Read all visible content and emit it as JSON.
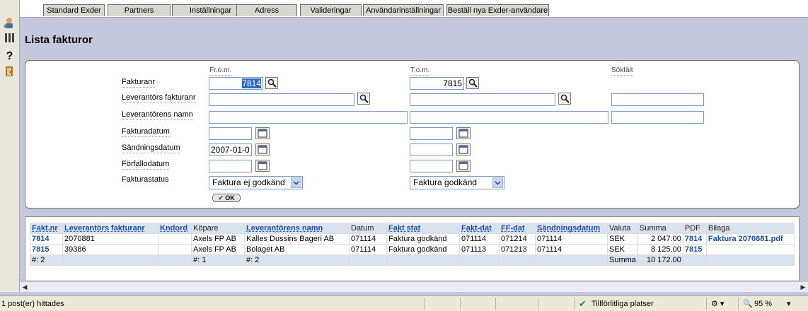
{
  "tabs": [
    "Standard Exder",
    "Partners",
    "Inställningar",
    "Adress",
    "Valideringar",
    "Användarinställningar",
    "Beställ nya Exder-användare"
  ],
  "left_icons": [
    "user-gear-icon",
    "columns-icon",
    "help-icon",
    "exit-door-icon"
  ],
  "page_title": "Lista fakturor",
  "form": {
    "col_from": "Fr.o.m.",
    "col_to": "T.o.m.",
    "col_search": "Sökfält",
    "labels": {
      "fakturanr": "Fakturanr",
      "lev_fakturanr": "Leverantörs fakturanr",
      "lev_namn": "Leverantörens namn",
      "fakturadatum": "Fakturadatum",
      "sandningsdatum": "Sändningsdatum",
      "forfallodatum": "Förfallodatum",
      "fakturastatus": "Fakturastatus"
    },
    "values": {
      "fakturanr_from": "7814",
      "fakturanr_to": "7815",
      "lev_fakturanr_from": "",
      "lev_fakturanr_to": "",
      "lev_fakturanr_search": "",
      "lev_namn_from": "",
      "lev_namn_to": "",
      "lev_namn_search": "",
      "fakturadatum_from": "",
      "fakturadatum_to": "",
      "sandningsdatum_from": "2007-01-0",
      "sandningsdatum_to": "",
      "forfallodatum_from": "",
      "forfallodatum_to": "",
      "status_from": "Faktura ej godkänd",
      "status_to": "Faktura godkänd"
    },
    "ok_label": "OK"
  },
  "results": {
    "headers": [
      "Fakt.nr",
      "Leverantörs fakturanr",
      "Kndord",
      "Köpare",
      "Leverantörens namn",
      "Datum",
      "Fakt stat",
      "Fakt-dat",
      "FF-dat",
      "Sändningsdatum",
      "Valuta",
      "Summa",
      "PDF",
      "Bilaga"
    ],
    "rows": [
      [
        "7814",
        "2070881",
        "",
        "Axels FP AB",
        "Kalles Dussins Bageri AB",
        "071114",
        "Faktura godkänd",
        "071114",
        "071214",
        "071114",
        "SEK",
        "2 047.00",
        "7814",
        "Faktura 2070881.pdf"
      ],
      [
        "7815",
        "39386",
        "",
        "Axels FP AB",
        "Bolaget AB",
        "071114",
        "Faktura godkänd",
        "071113",
        "071213",
        "071114",
        "SEK",
        "8 125.00",
        "7815",
        ""
      ]
    ],
    "footer": {
      "count_fakt": "#: 2",
      "count_kopare": "#: 1",
      "count_lev": "#: 2",
      "summa_label": "Summa",
      "summa_value": "10 172.00"
    }
  },
  "statusbar": {
    "left_text": "1 post(er) hittades",
    "zone_text": "Tillförlitliga platser",
    "zoom": "95 %"
  },
  "colors": {
    "link": "#1c4f9c",
    "header_bg": "#dbe2ef",
    "page_bg": "#c5c8dc"
  }
}
